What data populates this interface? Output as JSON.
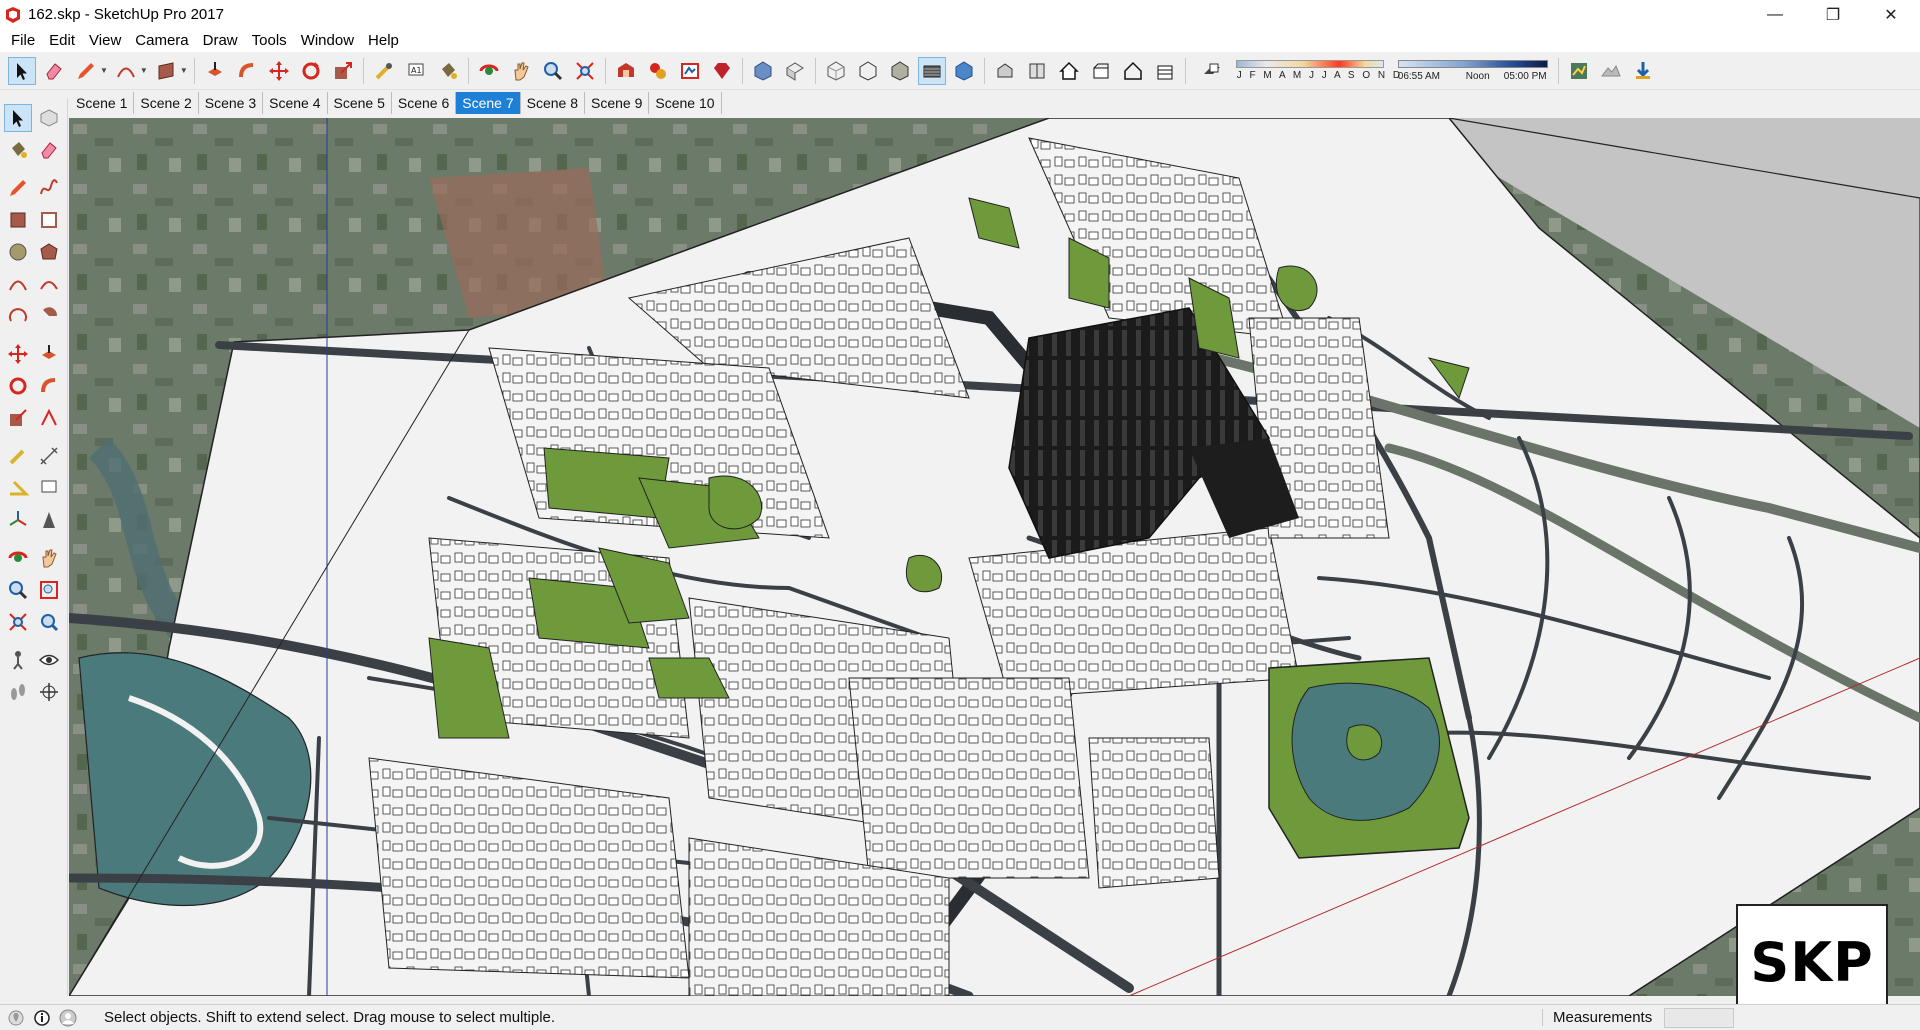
{
  "window": {
    "title": "162.skp - SketchUp Pro 2017",
    "controls": {
      "minimize": "—",
      "maximize": "❐",
      "close": "✕"
    }
  },
  "menu": [
    "File",
    "Edit",
    "View",
    "Camera",
    "Draw",
    "Tools",
    "Window",
    "Help"
  ],
  "toolbar": {
    "months_label": "J F M A M J J A S O N D",
    "time_start": "06:55 AM",
    "time_mid": "Noon",
    "time_end": "05:00 PM"
  },
  "scenes": {
    "active_index": 6,
    "tabs": [
      "Scene 1",
      "Scene 2",
      "Scene 3",
      "Scene 4",
      "Scene 5",
      "Scene 6",
      "Scene 7",
      "Scene 8",
      "Scene 9",
      "Scene 10"
    ]
  },
  "status": {
    "message": "Select objects. Shift to extend select. Drag mouse to select multiple.",
    "measurements_label": "Measurements",
    "measurements_value": ""
  },
  "badge": {
    "text": "SKP"
  },
  "colors": {
    "selection_blue": "#1e7fd6",
    "grass_green": "#6f9a3c",
    "water_teal": "#4a7a7c",
    "ground_white": "#f2f2f2",
    "road_dark": "#3b4046"
  }
}
